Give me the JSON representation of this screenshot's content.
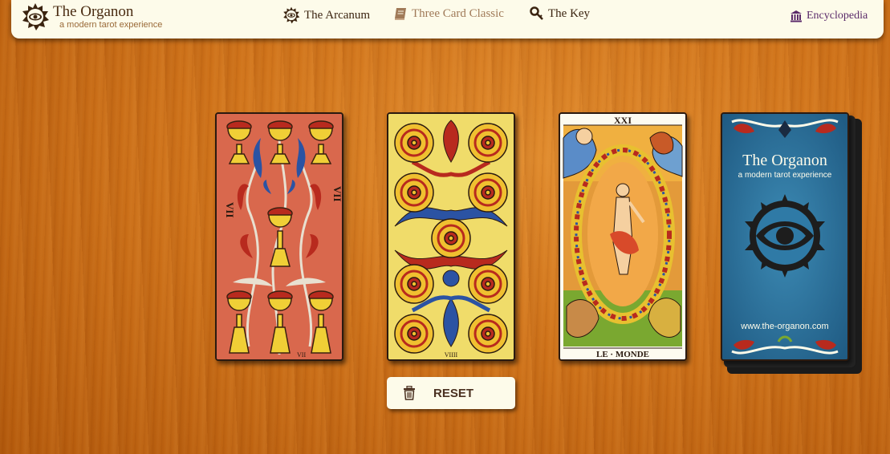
{
  "brand": {
    "title": "The Organon",
    "subtitle": "a modern tarot experience"
  },
  "nav": {
    "arcanum": "The Arcanum",
    "three_card": "Three Card Classic",
    "key": "The Key",
    "encyclopedia": "Encyclopedia"
  },
  "cards": {
    "card1": {
      "numeral_left": "VII",
      "numeral_right": "VII",
      "numeral_bottom": "VII"
    },
    "card2": {
      "numeral_bottom": "VIIII"
    },
    "card3": {
      "numeral_top": "XXI",
      "name": "LE · MONDE"
    }
  },
  "deck": {
    "title": "The Organon",
    "subtitle": "a modern tarot experience",
    "url": "www.the-organon.com"
  },
  "reset": {
    "label": "RESET"
  },
  "colors": {
    "header_bg": "#fdfbea",
    "deck_blue": "#2a6e96",
    "active_nav": "#a07a58",
    "encyclopedia": "#5a2a6a"
  }
}
